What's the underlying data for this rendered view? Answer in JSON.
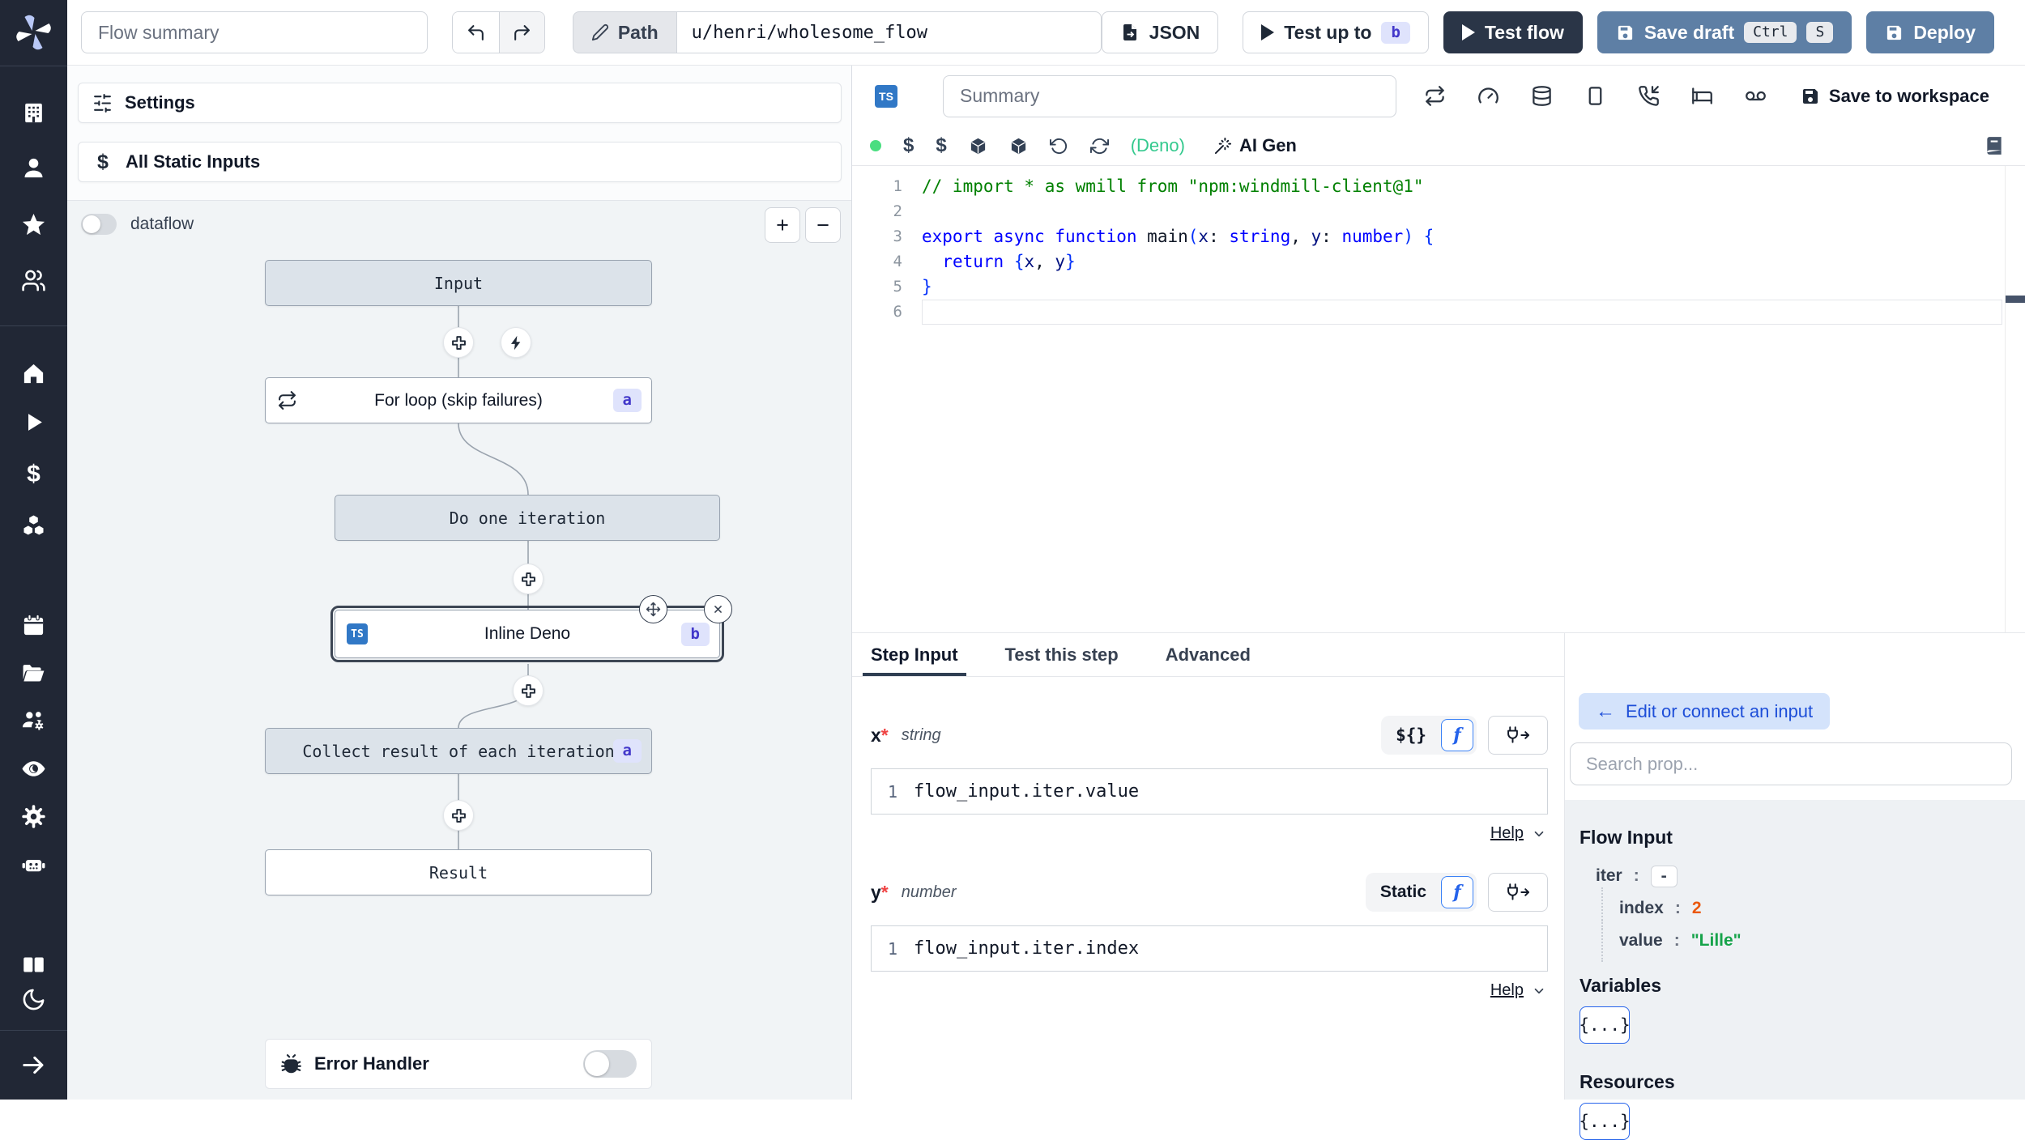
{
  "sidebar": {
    "icons": [
      "windmill-logo",
      "buildings",
      "user",
      "star",
      "users",
      "home",
      "play",
      "dollar",
      "boxes",
      "calendar",
      "folder-open",
      "users-gear",
      "eye",
      "settings-gear",
      "robot",
      "books",
      "moon",
      "collapse-arrow"
    ]
  },
  "topbar": {
    "flow_summary_placeholder": "Flow summary",
    "path_label": "Path",
    "path_value": "u/henri/wholesome_flow",
    "json_label": "JSON",
    "test_up_to_label": "Test up to",
    "test_up_to_badge": "b",
    "test_flow_label": "Test flow",
    "save_draft_label": "Save draft",
    "kbd_ctrl": "Ctrl",
    "kbd_s": "S",
    "deploy_label": "Deploy"
  },
  "flow_panel": {
    "settings_label": "Settings",
    "static_inputs_label": "All Static Inputs",
    "dataflow_label": "dataflow",
    "zoom_in_label": "+",
    "zoom_out_label": "−",
    "nodes": {
      "input": {
        "label": "Input"
      },
      "forloop": {
        "label": "For loop (skip failures)",
        "badge": "a"
      },
      "iteration": {
        "label": "Do one iteration"
      },
      "inline": {
        "label": "Inline Deno",
        "badge": "b",
        "lang": "TS"
      },
      "collect": {
        "label": "Collect result of each iteration",
        "badge": "a"
      },
      "result": {
        "label": "Result"
      }
    },
    "error_handler_label": "Error Handler"
  },
  "editor": {
    "lang_badge": "TS",
    "summary_placeholder": "Summary",
    "header_icons": [
      "repeat",
      "gauge",
      "database",
      "tablet",
      "phone-incoming",
      "bed",
      "voicemail"
    ],
    "save_to_workspace_label": "Save to workspace",
    "dollar_1": "$",
    "dollar_2": "$",
    "runtime_label": "(Deno)",
    "ai_gen_label": "AI Gen",
    "status_color": "#4ade80",
    "code_lines": [
      {
        "n": "1",
        "tokens": [
          {
            "t": "// import * as wmill from \"npm:windmill-client@1\"",
            "c": "tok-comment"
          }
        ]
      },
      {
        "n": "2",
        "tokens": []
      },
      {
        "n": "3",
        "tokens": [
          {
            "t": "export ",
            "c": "tok-kw"
          },
          {
            "t": "async ",
            "c": "tok-kw"
          },
          {
            "t": "function ",
            "c": "tok-kw"
          },
          {
            "t": "main",
            "c": "tok-plain"
          },
          {
            "t": "(",
            "c": "tok-brace"
          },
          {
            "t": "x",
            "c": "tok-var"
          },
          {
            "t": ": ",
            "c": "tok-plain"
          },
          {
            "t": "string",
            "c": "tok-kw"
          },
          {
            "t": ", ",
            "c": "tok-plain"
          },
          {
            "t": "y",
            "c": "tok-var"
          },
          {
            "t": ": ",
            "c": "tok-plain"
          },
          {
            "t": "number",
            "c": "tok-kw"
          },
          {
            "t": ") ",
            "c": "tok-brace"
          },
          {
            "t": "{",
            "c": "tok-brace"
          }
        ]
      },
      {
        "n": "4",
        "tokens": [
          {
            "t": "  ",
            "c": "tok-plain"
          },
          {
            "t": "return ",
            "c": "tok-kw"
          },
          {
            "t": "{",
            "c": "tok-brace"
          },
          {
            "t": "x",
            "c": "tok-var"
          },
          {
            "t": ", ",
            "c": "tok-plain"
          },
          {
            "t": "y",
            "c": "tok-var"
          },
          {
            "t": "}",
            "c": "tok-brace"
          }
        ]
      },
      {
        "n": "5",
        "tokens": [
          {
            "t": "}",
            "c": "tok-brace"
          }
        ]
      },
      {
        "n": "6",
        "tokens": [],
        "current": true
      }
    ]
  },
  "step_panel": {
    "tabs": [
      "Step Input",
      "Test this step",
      "Advanced"
    ],
    "fields": [
      {
        "name": "x",
        "required": "*",
        "type": "string",
        "mode_label": "${}",
        "fn_label": "f",
        "expr_line": "1",
        "expr": "flow_input.iter.value",
        "help_label": "Help"
      },
      {
        "name": "y",
        "required": "*",
        "type": "number",
        "mode_label": "Static",
        "fn_label": "f",
        "expr_line": "1",
        "expr": "flow_input.iter.index",
        "help_label": "Help"
      }
    ]
  },
  "connect_panel": {
    "edit_button_arrow": "←",
    "edit_button_label": "Edit or connect an input",
    "search_placeholder": "Search prop...",
    "flow_input_title": "Flow Input",
    "props": [
      {
        "key": "iter",
        "colon": ":",
        "value": "-",
        "kind": "dash",
        "indent": 0
      },
      {
        "key": "index",
        "colon": ":",
        "value": "2",
        "kind": "number",
        "indent": 1
      },
      {
        "key": "value",
        "colon": ":",
        "value": "\"Lille\"",
        "kind": "string",
        "indent": 1
      }
    ],
    "variables_title": "Variables",
    "variables_button": "{...}",
    "resources_title": "Resources",
    "resources_button": "{...}"
  },
  "colors": {
    "sidebar_bg": "#212735",
    "steel_button": "#5e7fa5",
    "dark_button": "#2a3547",
    "badge_bg": "#dfe3fc",
    "badge_fg": "#4338ca",
    "status_green": "#4ade80",
    "deno_green": "#34c98e",
    "string_green": "#16a34a",
    "number_orange": "#ea580c",
    "ts_blue": "#3178c6",
    "connect_button_bg": "#d4e3fb",
    "connect_button_fg": "#1d4ed8"
  }
}
